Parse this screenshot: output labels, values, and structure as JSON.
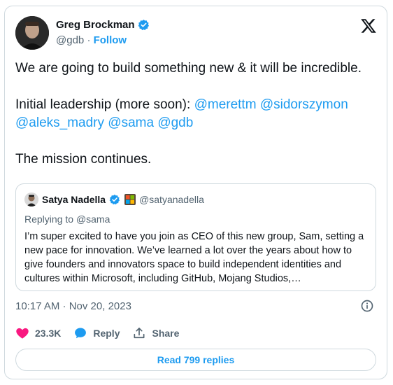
{
  "author": {
    "display_name": "Greg Brockman",
    "handle": "@gdb",
    "separator": "·",
    "follow_label": "Follow"
  },
  "tweet": {
    "paragraph1": "We are going to build something new & it will be incredible.",
    "paragraph2_prefix": "Initial leadership (more soon): ",
    "mentions": [
      "@merettm",
      "@sidorszymon",
      "@aleks_madry",
      "@sama",
      "@gdb"
    ],
    "paragraph3": "The mission continues."
  },
  "quote": {
    "display_name": "Satya Nadella",
    "handle": "@satyanadella",
    "replying_to_prefix": "Replying to ",
    "replying_to_handle": "@sama",
    "body": "I’m super excited to have you join as CEO of this new group, Sam, setting a new pace for innovation. We’ve learned a lot over the years about how to give founders and innovators space to build independent identities and cultures within Microsoft, including GitHub, Mojang Studios,…"
  },
  "meta": {
    "timestamp": "10:17 AM · Nov 20, 2023"
  },
  "actions": {
    "like_count": "23.3K",
    "reply_label": "Reply",
    "share_label": "Share"
  },
  "read_replies_label": "Read 799 replies",
  "icons": {
    "verified": "verified-badge-icon",
    "x_logo": "x-logo-icon",
    "like": "heart-icon",
    "reply": "speech-bubble-icon",
    "share": "share-icon",
    "info": "info-icon",
    "affiliation": "microsoft-affiliation-icon"
  },
  "colors": {
    "link_blue": "#1d9bf0",
    "like_pink": "#f91880",
    "secondary_text": "#536471",
    "border": "#cfd9de"
  }
}
